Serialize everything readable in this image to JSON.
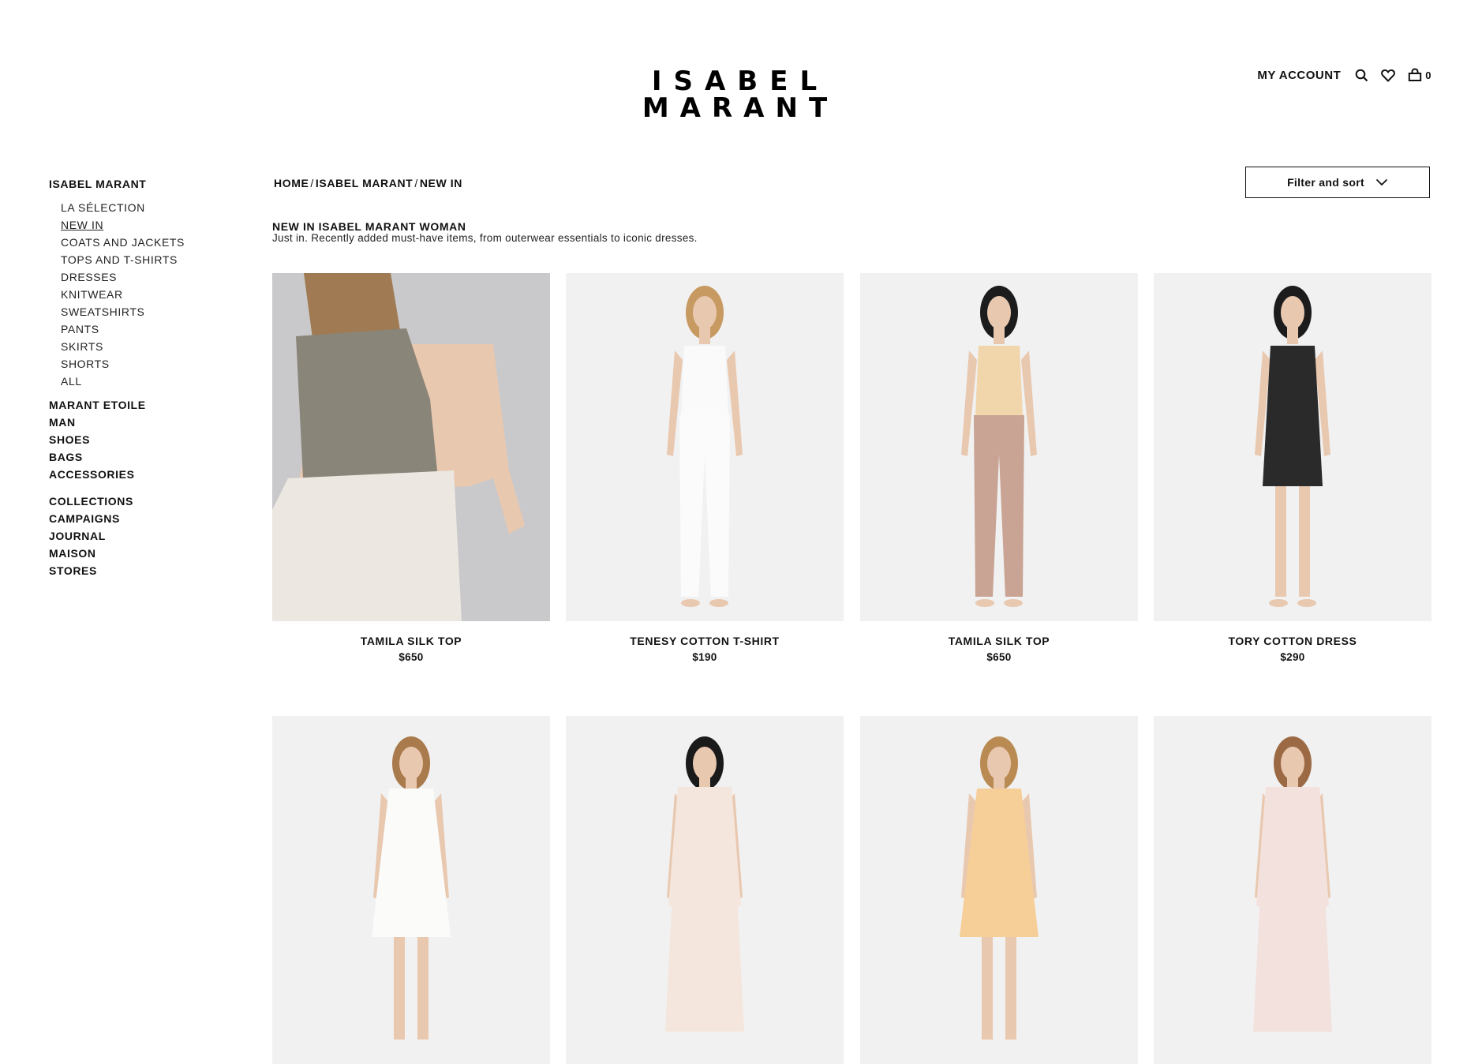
{
  "header": {
    "logo_line1": "ISABEL",
    "logo_line2": "MARANT",
    "account_label": "MY ACCOUNT",
    "cart_count": "0",
    "icons": [
      "search-icon",
      "heart-icon",
      "bag-icon"
    ]
  },
  "sidebar": {
    "main_label": "ISABEL MARANT",
    "sub_items": [
      "LA SÉLECTION",
      "NEW IN",
      "COATS AND JACKETS",
      "TOPS AND T-SHIRTS",
      "DRESSES",
      "KNITWEAR",
      "SWEATSHIRTS",
      "PANTS",
      "SKIRTS",
      "SHORTS",
      "ALL"
    ],
    "active_item": "NEW IN",
    "group1": [
      "MARANT ETOILE",
      "MAN",
      "SHOES",
      "BAGS",
      "ACCESSORIES"
    ],
    "group2": [
      "COLLECTIONS",
      "CAMPAIGNS",
      "JOURNAL",
      "MAISON",
      "STORES"
    ]
  },
  "breadcrumb": [
    "HOME",
    "ISABEL MARANT",
    "NEW IN"
  ],
  "breadcrumb_sep": "/",
  "filter": {
    "label": "Filter and sort"
  },
  "intro": {
    "title": "NEW IN ISABEL MARANT WOMAN",
    "description": "Just in. Recently added must-have items, from outerwear essentials to iconic dresses."
  },
  "products": [
    {
      "name": "TAMILA SILK TOP",
      "price": "$650",
      "bg": "#c9c9cb",
      "garment": "#ece7e1",
      "accent": "#8a8579",
      "hair": "#a07a52"
    },
    {
      "name": "TENESY COTTON T-SHIRT",
      "price": "$190",
      "bg": "#f1f1f1",
      "garment": "#fafafa",
      "accent": "#e6e6e6",
      "hair": "#c79a62"
    },
    {
      "name": "TAMILA SILK TOP",
      "price": "$650",
      "bg": "#f1f1f1",
      "garment": "#f1d6ab",
      "accent": "#c9a393",
      "hair": "#1c1c1c"
    },
    {
      "name": "TORY COTTON DRESS",
      "price": "$290",
      "bg": "#f1f1f1",
      "garment": "#2a2a2a",
      "accent": "#2a2a2a",
      "hair": "#1c1c1c"
    },
    {
      "name": "",
      "price": "",
      "bg": "#f1f1f1",
      "garment": "#fbfbfa",
      "accent": "#f5f5f3",
      "hair": "#a87a4c"
    },
    {
      "name": "",
      "price": "",
      "bg": "#f1f1f1",
      "garment": "#f4e6dc",
      "accent": "#e07c6f",
      "hair": "#1a1a1a"
    },
    {
      "name": "",
      "price": "",
      "bg": "#f1f1f1",
      "garment": "#f6cf98",
      "accent": "#f6cf98",
      "hair": "#b98b53"
    },
    {
      "name": "",
      "price": "",
      "bg": "#f1f1f1",
      "garment": "#f3e1de",
      "accent": "#f3e1de",
      "hair": "#9b6a44"
    }
  ]
}
